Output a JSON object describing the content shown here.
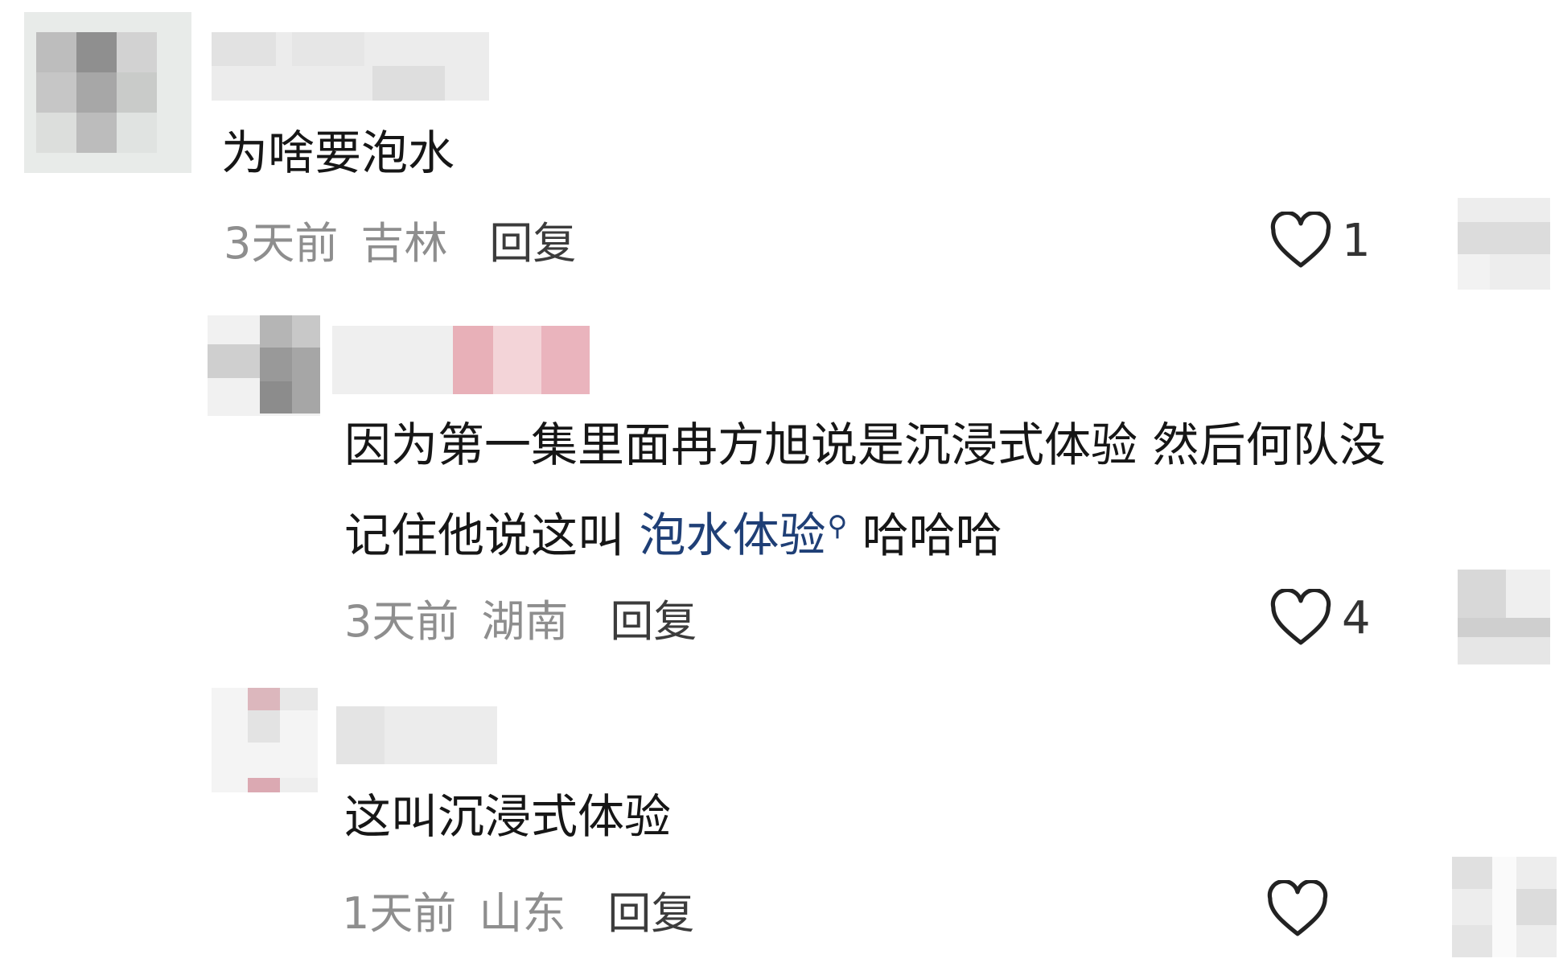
{
  "comments": [
    {
      "text": "为啥要泡水",
      "time": "3天前",
      "location": "吉林",
      "reply_label": "回复",
      "likes": "1"
    },
    {
      "text_line1": "因为第一集里面冉方旭说是沉浸式体验 然后何队没",
      "text_line2_prefix": "记住他说这叫 ",
      "text_link": "泡水体验",
      "text_line2_suffix": " 哈哈哈",
      "time": "3天前",
      "location": "湖南",
      "reply_label": "回复",
      "likes": "4"
    },
    {
      "text": "这叫沉浸式体验",
      "time": "1天前",
      "location": "山东",
      "reply_label": "回复",
      "likes": ""
    }
  ],
  "icons": {
    "like": "heart-outline-icon",
    "search": "search-icon"
  },
  "colors": {
    "text": "#161616",
    "meta": "#8e8e8e",
    "reply": "#3c3c3c",
    "link": "#1f3f76"
  }
}
